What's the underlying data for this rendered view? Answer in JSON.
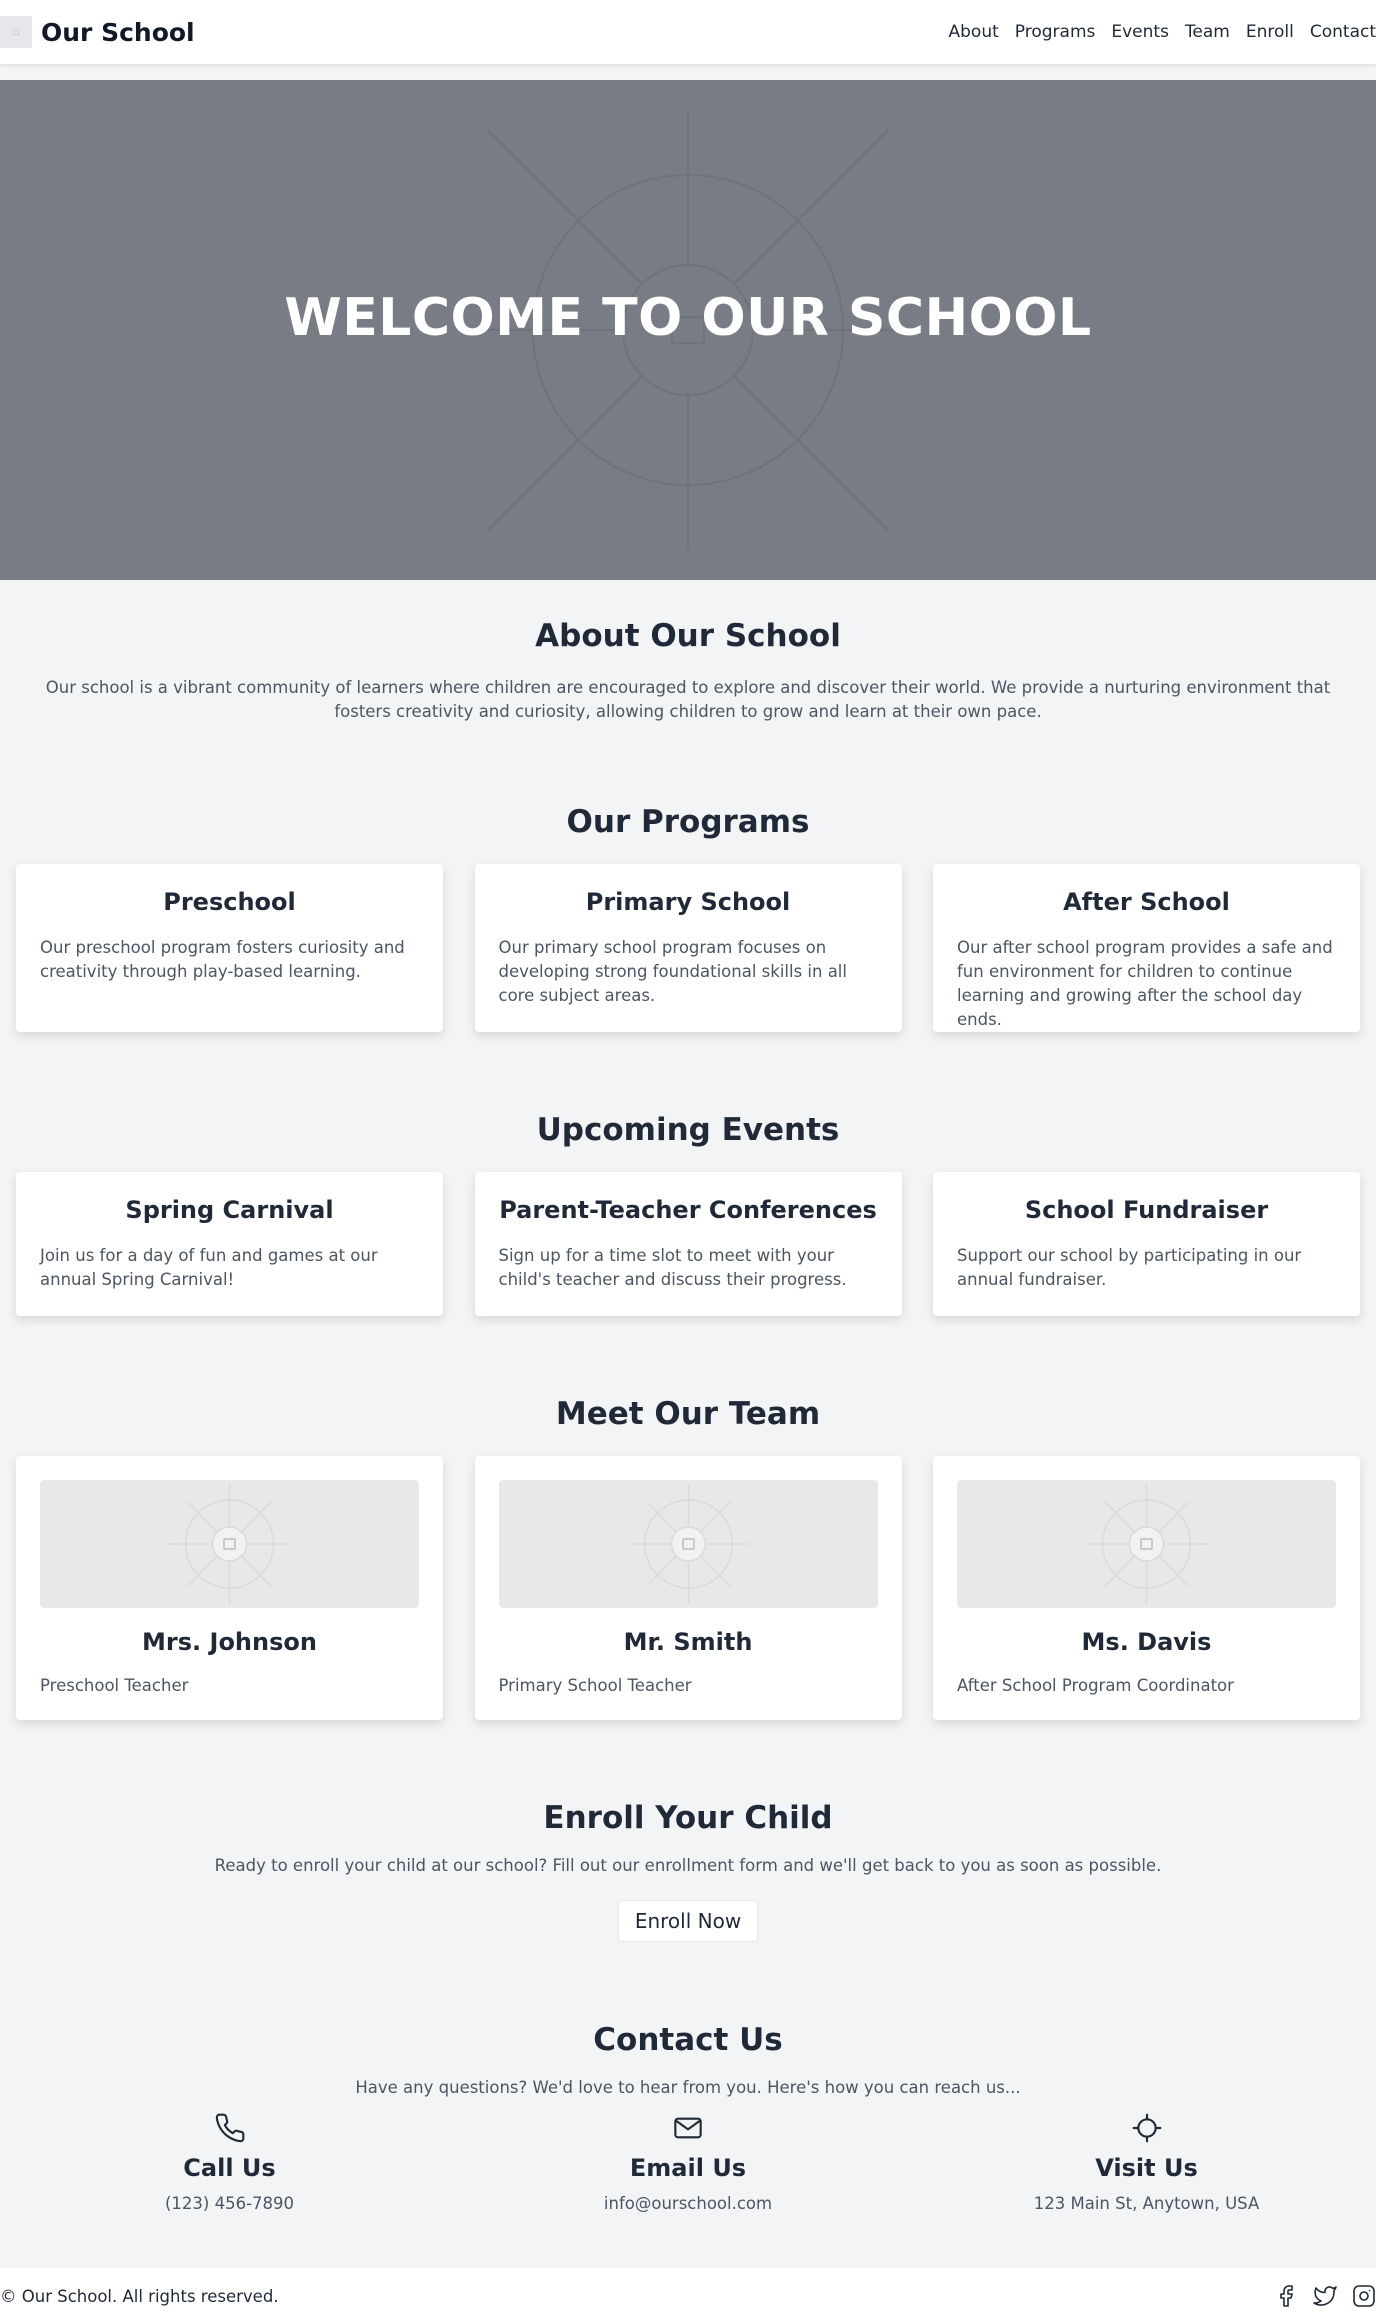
{
  "header": {
    "brand": "Our School",
    "nav": [
      "About",
      "Programs",
      "Events",
      "Team",
      "Enroll",
      "Contact"
    ]
  },
  "hero": {
    "title": "WELCOME TO OUR SCHOOL"
  },
  "about": {
    "title": "About Our School",
    "text": "Our school is a vibrant community of learners where children are encouraged to explore and discover their world. We provide a nurturing environment that fosters creativity and curiosity, allowing children to grow and learn at their own pace."
  },
  "programs": {
    "title": "Our Programs",
    "items": [
      {
        "title": "Preschool",
        "text": "Our preschool program fosters curiosity and creativity through play-based learning."
      },
      {
        "title": "Primary School",
        "text": "Our primary school program focuses on developing strong foundational skills in all core subject areas."
      },
      {
        "title": "After School",
        "text": "Our after school program provides a safe and fun environment for children to continue learning and growing after the school day ends."
      }
    ]
  },
  "events": {
    "title": "Upcoming Events",
    "items": [
      {
        "title": "Spring Carnival",
        "text": "Join us for a day of fun and games at our annual Spring Carnival!"
      },
      {
        "title": "Parent-Teacher Conferences",
        "text": "Sign up for a time slot to meet with your child's teacher and discuss their progress."
      },
      {
        "title": "School Fundraiser",
        "text": "Support our school by participating in our annual fundraiser."
      }
    ]
  },
  "team": {
    "title": "Meet Our Team",
    "members": [
      {
        "name": "Mrs. Johnson",
        "role": "Preschool Teacher"
      },
      {
        "name": "Mr. Smith",
        "role": "Primary School Teacher"
      },
      {
        "name": "Ms. Davis",
        "role": "After School Program Coordinator"
      }
    ]
  },
  "enroll": {
    "title": "Enroll Your Child",
    "text": "Ready to enroll your child at our school? Fill out our enrollment form and we'll get back to you as soon as possible.",
    "button": "Enroll Now"
  },
  "contact": {
    "title": "Contact Us",
    "text": "Have any questions? We'd love to hear from you. Here's how you can reach us...",
    "items": [
      {
        "icon": "phone-icon",
        "title": "Call Us",
        "value": "(123) 456-7890"
      },
      {
        "icon": "mail-icon",
        "title": "Email Us",
        "value": "info@ourschool.com"
      },
      {
        "icon": "location-icon",
        "title": "Visit Us",
        "value": "123 Main St, Anytown, USA"
      }
    ]
  },
  "footer": {
    "text": "© Our School. All rights reserved.",
    "socials": [
      "facebook-icon",
      "twitter-icon",
      "instagram-icon"
    ]
  },
  "colors": {
    "background": "#f3f4f6",
    "hero": "#787d85",
    "text_dark": "#1f2937",
    "text_muted": "#4b5563",
    "card": "#ffffff"
  }
}
